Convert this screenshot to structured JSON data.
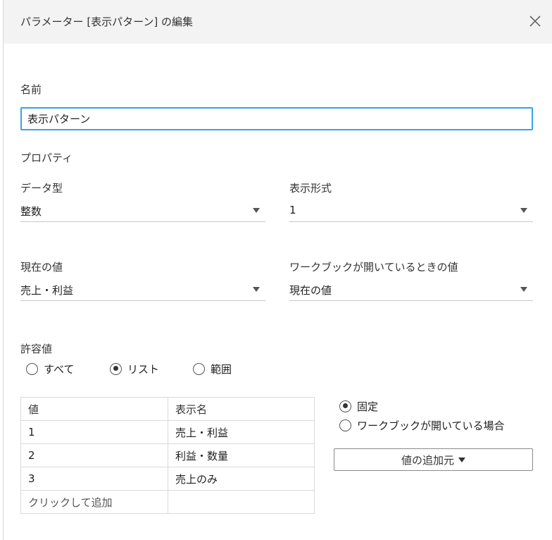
{
  "dialog": {
    "title": "パラメーター [表示パターン] の編集"
  },
  "name": {
    "label": "名前",
    "value": "表示パターン"
  },
  "properties": {
    "heading": "プロパティ",
    "data_type": {
      "label": "データ型",
      "value": "整数"
    },
    "display_format": {
      "label": "表示形式",
      "value": "1"
    },
    "current_value": {
      "label": "現在の値",
      "value": "売上・利益"
    },
    "workbook_open_value": {
      "label": "ワークブックが開いているときの値",
      "value": "現在の値"
    }
  },
  "allowed_values": {
    "label": "許容値",
    "options": [
      {
        "label": "すべて",
        "selected": false
      },
      {
        "label": "リスト",
        "selected": true
      },
      {
        "label": "範囲",
        "selected": false
      }
    ]
  },
  "value_table": {
    "headers": [
      "値",
      "表示名"
    ],
    "rows": [
      [
        "1",
        "売上・利益"
      ],
      [
        "2",
        "利益・数量"
      ],
      [
        "3",
        "売上のみ"
      ]
    ],
    "add_row_label": "クリックして追加"
  },
  "list_source": {
    "options": [
      {
        "label": "固定",
        "selected": true
      },
      {
        "label": "ワークブックが開いている場合",
        "selected": false
      }
    ],
    "add_from_button": "値の追加元"
  },
  "icons": {
    "close": "close-icon",
    "dropdown": "triangle-down-icon"
  }
}
